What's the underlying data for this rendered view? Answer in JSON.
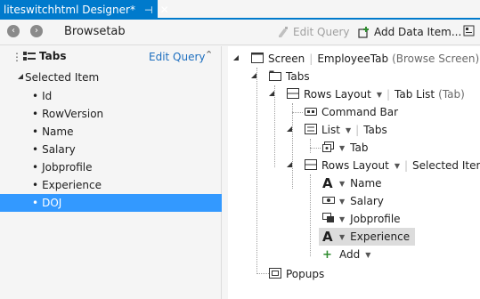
{
  "tab": {
    "title": "liteswitchhtml Designer*",
    "pin": "⊣",
    "close": "✕"
  },
  "toolbar": {
    "back": "‹",
    "forward": "›",
    "screen_name": "Browsetab",
    "edit_query": "Edit Query",
    "add_data_item": "Add Data Item..."
  },
  "left": {
    "grip": "⋮",
    "title": "Tabs",
    "edit_query": "Edit Query",
    "collapse": "⌃",
    "selected_item": "Selected Item",
    "fields": [
      "Id",
      "RowVersion",
      "Name",
      "Salary",
      "Jobprofile",
      "Experience",
      "DOJ"
    ],
    "selected_field": "DOJ"
  },
  "tree": {
    "screen": {
      "label": "Screen",
      "name": "EmployeeTab",
      "kind": "(Browse Screen)"
    },
    "tabs": "Tabs",
    "rows_layout_1": {
      "label": "Rows Layout",
      "name": "Tab List",
      "kind": "(Tab)"
    },
    "command_bar": "Command Bar",
    "list": {
      "label": "List",
      "name": "Tabs"
    },
    "tab": "Tab",
    "rows_layout_2": {
      "label": "Rows Layout",
      "name": "Selected Item"
    },
    "items": [
      {
        "name": "Name",
        "icon": "text-A-icon"
      },
      {
        "name": "Salary",
        "icon": "money-icon"
      },
      {
        "name": "Jobprofile",
        "icon": "picker-icon"
      },
      {
        "name": "Experience",
        "icon": "text-A-icon"
      }
    ],
    "add": "Add",
    "popups": "Popups"
  },
  "colors": {
    "accent": "#007acc",
    "selection": "#3399ff",
    "add_green": "#2e8b2e"
  }
}
